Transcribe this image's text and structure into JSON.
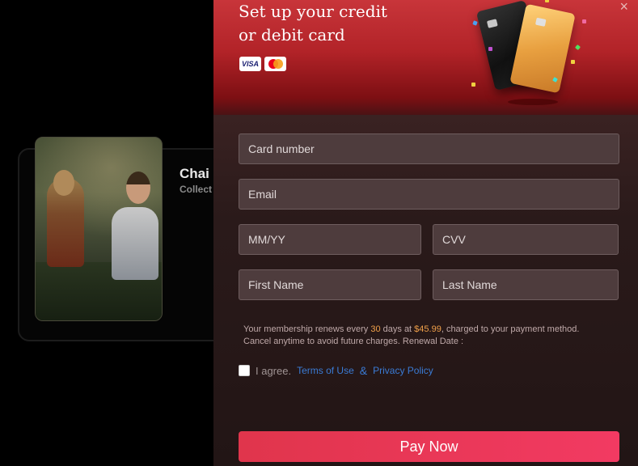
{
  "background": {
    "card_title": "Chai",
    "card_subtitle": "Collect"
  },
  "modal": {
    "title_line1": "Set up your credit",
    "title_line2": "or debit card",
    "close_icon": "×",
    "card_brands": [
      "VISA",
      "mastercard"
    ],
    "accent_color": "#b22328"
  },
  "form": {
    "card_number_placeholder": "Card number",
    "email_placeholder": "Email",
    "expiry_placeholder": "MM/YY",
    "cvv_placeholder": "CVV",
    "first_name_placeholder": "First Name",
    "last_name_placeholder": "Last Name"
  },
  "terms": {
    "text1": "Your membership renews every ",
    "days": "30",
    "text2": " days at ",
    "price": "$45.99",
    "text3": ", charged to your payment method.",
    "line2": "Cancel anytime to avoid future charges. Renewal Date :"
  },
  "agree": {
    "label": "I agree.",
    "terms_link": "Terms of Use",
    "amp": "&",
    "privacy_link": "Privacy Policy"
  },
  "pay_button": {
    "label": "Pay Now",
    "color": "#f23a62"
  }
}
